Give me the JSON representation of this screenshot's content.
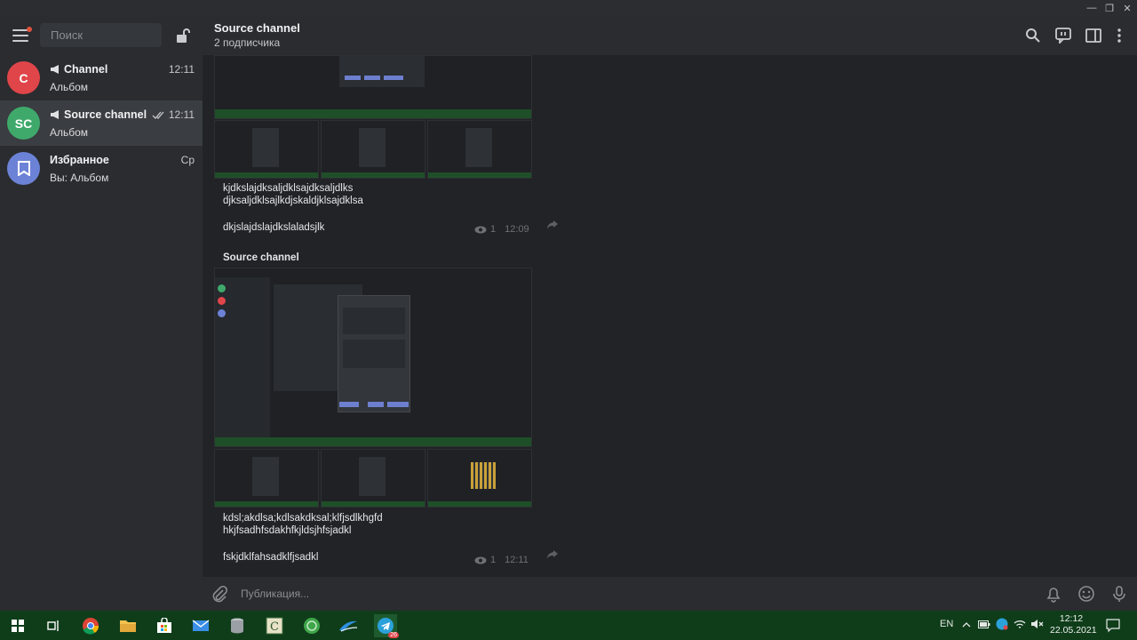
{
  "window": {
    "minimize": "—",
    "maximize": "❐",
    "close": "✕"
  },
  "sidebar": {
    "search_placeholder": "Поиск",
    "chats": [
      {
        "initials": "C",
        "avatar_color": "#e0454a",
        "name": "Channel",
        "time": "12:11",
        "preview": "Альбом"
      },
      {
        "initials": "SC",
        "avatar_color": "#3fa96b",
        "name": "Source channel",
        "time": "12:11",
        "preview": "Альбом",
        "read": true
      },
      {
        "initials": "",
        "avatar_color": "#6c82d6",
        "name": "Избранное",
        "time": "Ср",
        "preview": "Вы: Альбом"
      }
    ]
  },
  "header": {
    "title": "Source channel",
    "subtitle": "2 подписчика"
  },
  "messages": [
    {
      "caption_lines": [
        "kjdkslajdksaljdklsajdksaljdlks",
        "djksaljdklsajlkdjskaldjklsajdklsa"
      ],
      "last_line": "dkjslajdslajdkslaladsjlk",
      "views": "1",
      "time": "12:09"
    },
    {
      "author": "Source channel",
      "caption_lines": [
        "kdsl;akdlsa;kdlsakdksal;klfjsdlkhgfd",
        "hkjfsadhfsdakhfkjldsjhfsjadkl"
      ],
      "last_line": "fskjdklfahsadklfjsadkl",
      "views": "1",
      "time": "12:11"
    }
  ],
  "composer": {
    "placeholder": "Публикация..."
  },
  "taskbar": {
    "lang": "EN",
    "time": "12:12",
    "date": "22.05.2021",
    "telegram_badge": "26"
  }
}
